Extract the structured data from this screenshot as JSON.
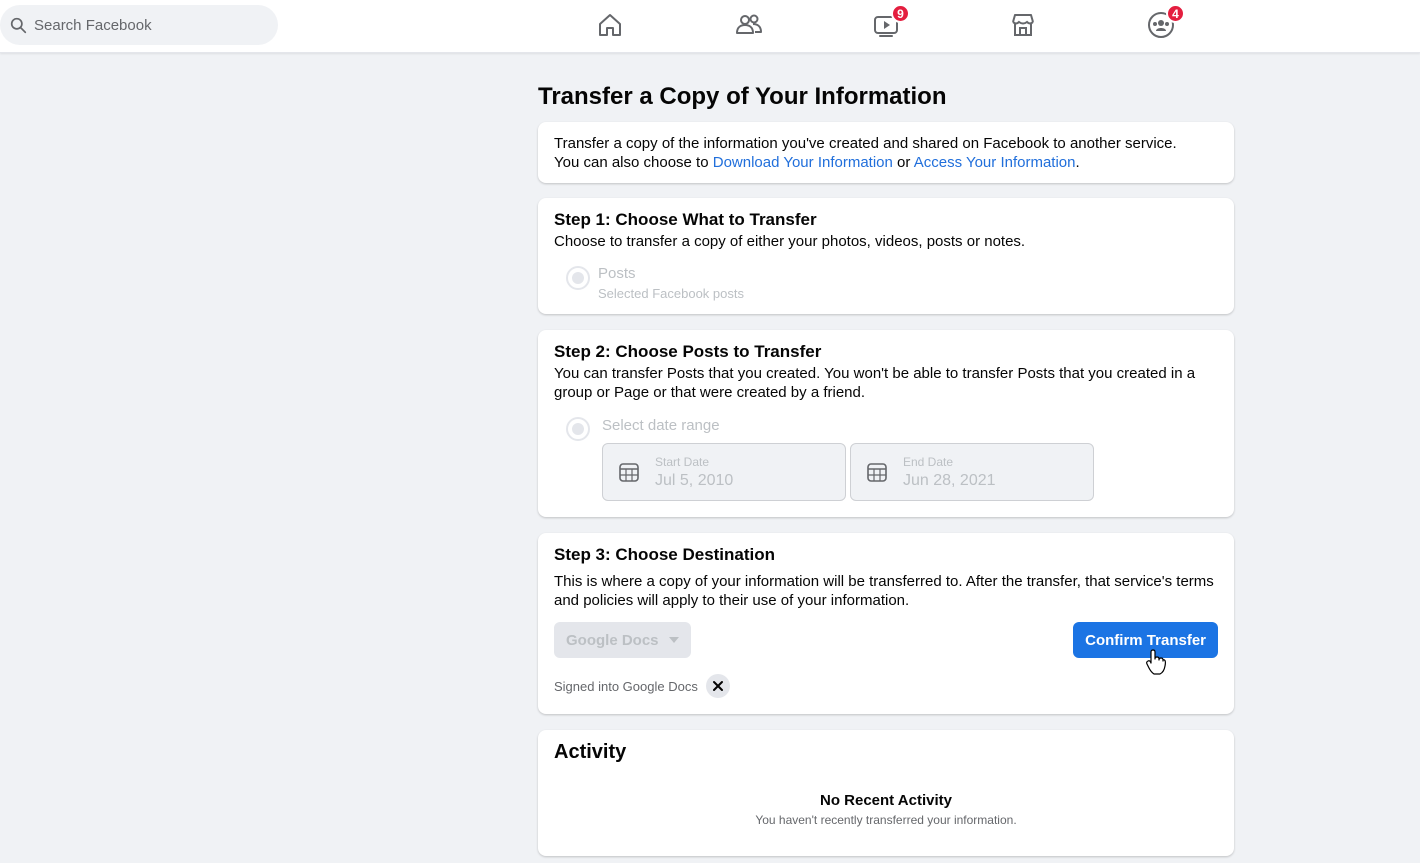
{
  "search": {
    "placeholder": "Search Facebook"
  },
  "nav": {
    "items": [
      {
        "icon": "home-icon",
        "badge": ""
      },
      {
        "icon": "friends-icon",
        "badge": ""
      },
      {
        "icon": "watch-icon",
        "badge": "9"
      },
      {
        "icon": "marketplace-icon",
        "badge": ""
      },
      {
        "icon": "groups-icon",
        "badge": "4"
      }
    ]
  },
  "page": {
    "title": "Transfer a Copy of Your Information"
  },
  "intro": {
    "line1": "Transfer a copy of the information you've created and shared on Facebook to another service.",
    "line2_prefix": "You can also choose to ",
    "link1": "Download Your Information",
    "middle": " or ",
    "link2": "Access Your Information",
    "suffix": "."
  },
  "step1": {
    "title": "Step 1: Choose What to Transfer",
    "description": "Choose to transfer a copy of either your photos, videos, posts or notes.",
    "option_label": "Posts",
    "option_sublabel": "Selected Facebook posts"
  },
  "step2": {
    "title": "Step 2: Choose Posts to Transfer",
    "description": "You can transfer Posts that you created. You won't be able to transfer Posts that you created in a group or Page or that were created by a friend.",
    "option_label": "Select date range",
    "start_label": "Start Date",
    "start_value": "Jul 5, 2010",
    "end_label": "End Date",
    "end_value": "Jun 28, 2021"
  },
  "step3": {
    "title": "Step 3: Choose Destination",
    "description": "This is where a copy of your information will be transferred to. After the transfer, that service's terms and policies will apply to their use of your information.",
    "destination": "Google Docs",
    "confirm_label": "Confirm Transfer",
    "signed_in": "Signed into Google Docs"
  },
  "activity": {
    "title": "Activity",
    "empty_title": "No Recent Activity",
    "empty_subtitle": "You haven't recently transferred your information."
  },
  "colors": {
    "accent": "#1b74e4",
    "link": "#216fdb",
    "badge": "#e41e3f",
    "background": "#f0f2f5"
  }
}
